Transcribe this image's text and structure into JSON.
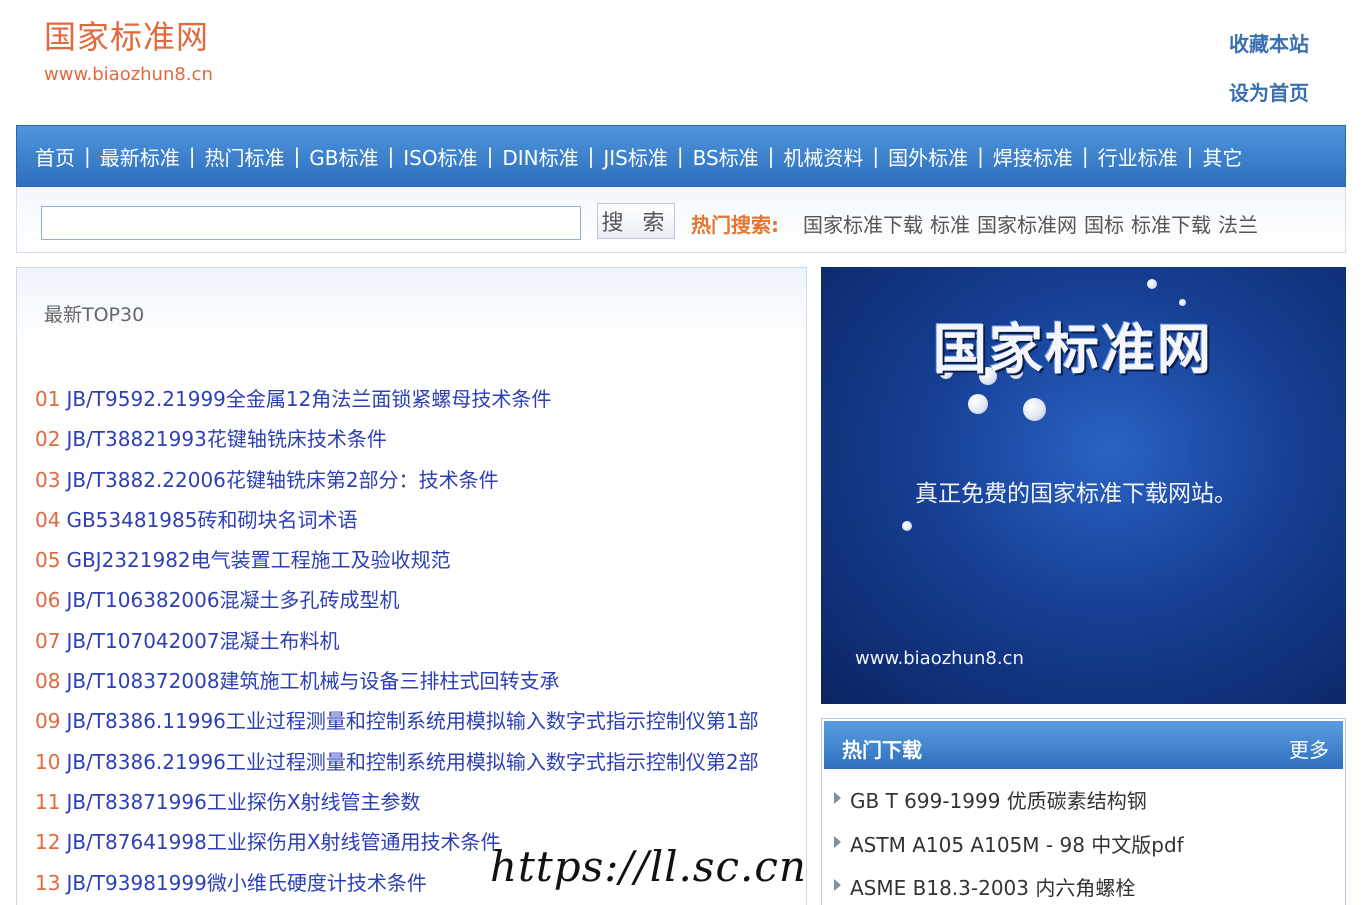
{
  "header": {
    "site_title": "国家标准网",
    "site_url": "www.biaozhun8.cn",
    "bookmark_label": "收藏本站",
    "set_home_label": "设为首页"
  },
  "nav": {
    "items": [
      "首页",
      "最新标准",
      "热门标准",
      "GB标准",
      "ISO标准",
      "DIN标准",
      "JIS标准",
      "BS标准",
      "机械资料",
      "国外标准",
      "焊接标准",
      "行业标准",
      "其它"
    ],
    "separator": "|"
  },
  "search": {
    "input_value": "",
    "button_label": "搜 索",
    "hot_label": "热门搜索:",
    "hot_keywords": [
      "国家标准下载",
      "标准",
      "国家标准网",
      "国标",
      "标准下载",
      "法兰"
    ]
  },
  "top30": {
    "title": "最新TOP30",
    "items": [
      {
        "num": "01",
        "title": "JB/T9592.21999全金属12角法兰面锁紧螺母技术条件"
      },
      {
        "num": "02",
        "title": "JB/T38821993花键轴铣床技术条件"
      },
      {
        "num": "03",
        "title": "JB/T3882.22006花键轴铣床第2部分：技术条件"
      },
      {
        "num": "04",
        "title": "GB53481985砖和砌块名词术语"
      },
      {
        "num": "05",
        "title": "GBJ2321982电气装置工程施工及验收规范"
      },
      {
        "num": "06",
        "title": "JB/T106382006混凝土多孔砖成型机"
      },
      {
        "num": "07",
        "title": "JB/T107042007混凝土布料机"
      },
      {
        "num": "08",
        "title": "JB/T108372008建筑施工机械与设备三排柱式回转支承"
      },
      {
        "num": "09",
        "title": "JB/T8386.11996工业过程测量和控制系统用模拟输入数字式指示控制仪第1部"
      },
      {
        "num": "10",
        "title": "JB/T8386.21996工业过程测量和控制系统用模拟输入数字式指示控制仪第2部"
      },
      {
        "num": "11",
        "title": "JB/T83871996工业探伤X射线管主参数"
      },
      {
        "num": "12",
        "title": "JB/T87641998工业探伤用X射线管通用技术条件"
      },
      {
        "num": "13",
        "title": "JB/T93981999微小维氏硬度计技术条件"
      }
    ]
  },
  "banner": {
    "title": "国家标准网",
    "subtitle": "真正免费的国家标准下载网站。",
    "url": "www.biaozhun8.cn"
  },
  "hot_downloads": {
    "title": "热门下载",
    "more_label": "更多",
    "items": [
      "GB T 699-1999 优质碳素结构钢",
      "ASTM A105 A105M - 98 中文版pdf",
      "ASME B18.3-2003 内六角螺栓"
    ]
  },
  "watermark": "https://ll.sc.cn"
}
